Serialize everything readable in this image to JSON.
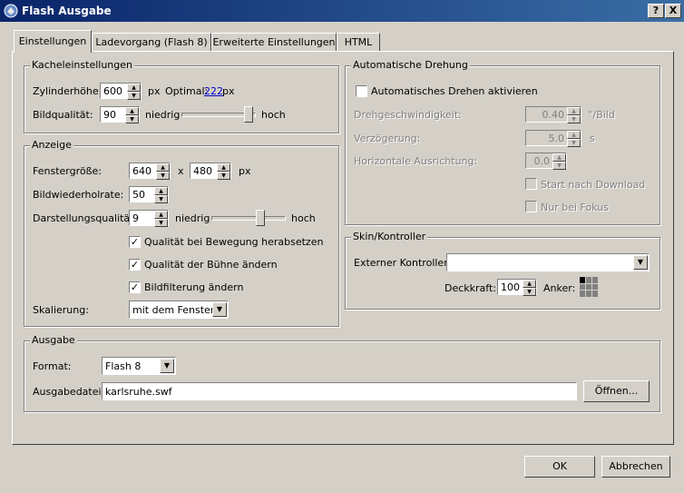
{
  "window": {
    "title": "Flash Ausgabe",
    "help_btn": "?",
    "close_btn": "X"
  },
  "tabs": [
    "Einstellungen",
    "Ladevorgang (Flash 8)",
    "Erweiterte Einstellungen",
    "HTML"
  ],
  "kachel": {
    "legend": "Kacheleinstellungen",
    "zyl_label": "Zylinderhöhe:",
    "zyl_value": "600",
    "zyl_unit": "px",
    "optimal_label": "Optimal:",
    "optimal_value": "222",
    "optimal_unit": "px",
    "qual_label": "Bildqualität:",
    "qual_value": "90",
    "low": "niedrig",
    "high": "hoch",
    "qual_level": 0.93
  },
  "anzeige": {
    "legend": "Anzeige",
    "fenster_label": "Fenstergröße:",
    "width": "640",
    "x": "x",
    "height": "480",
    "unit": "px",
    "rate_label": "Bildwiederholrate:",
    "rate_value": "50",
    "darst_label": "Darstellungsqualität:",
    "darst_value": "9",
    "low": "niedrig",
    "high": "hoch",
    "darst_level": 0.67,
    "cb1": "Qualität bei Bewegung herabsetzen",
    "cb2": "Qualität der Bühne ändern",
    "cb3": "Bildfilterung ändern",
    "skal_label": "Skalierung:",
    "skal_value": "mit dem Fenster"
  },
  "drehung": {
    "legend": "Automatische Drehung",
    "cb_label": "Automatisches Drehen aktivieren",
    "speed_label": "Drehgeschwindigkeit:",
    "speed_value": "0.40",
    "speed_unit": "°/Bild",
    "delay_label": "Verzögerung:",
    "delay_value": "5.0",
    "delay_unit": "s",
    "hor_label": "Horizontale Ausrichtung:",
    "hor_value": "0.0",
    "start_label": "Start nach Download",
    "fokus_label": "Nur bei Fokus"
  },
  "skin": {
    "legend": "Skin/Kontroller",
    "ext_label": "Externer Kontroller:",
    "ext_value": "",
    "deck_label": "Deckkraft:",
    "deck_value": "100",
    "anker_label": "Anker:"
  },
  "ausgabe": {
    "legend": "Ausgabe",
    "format_label": "Format:",
    "format_value": "Flash 8",
    "datei_label": "Ausgabedatei:",
    "datei_value": "karlsruhe.swf",
    "open_btn": "Öffnen..."
  },
  "buttons": {
    "ok": "OK",
    "cancel": "Abbrechen"
  }
}
